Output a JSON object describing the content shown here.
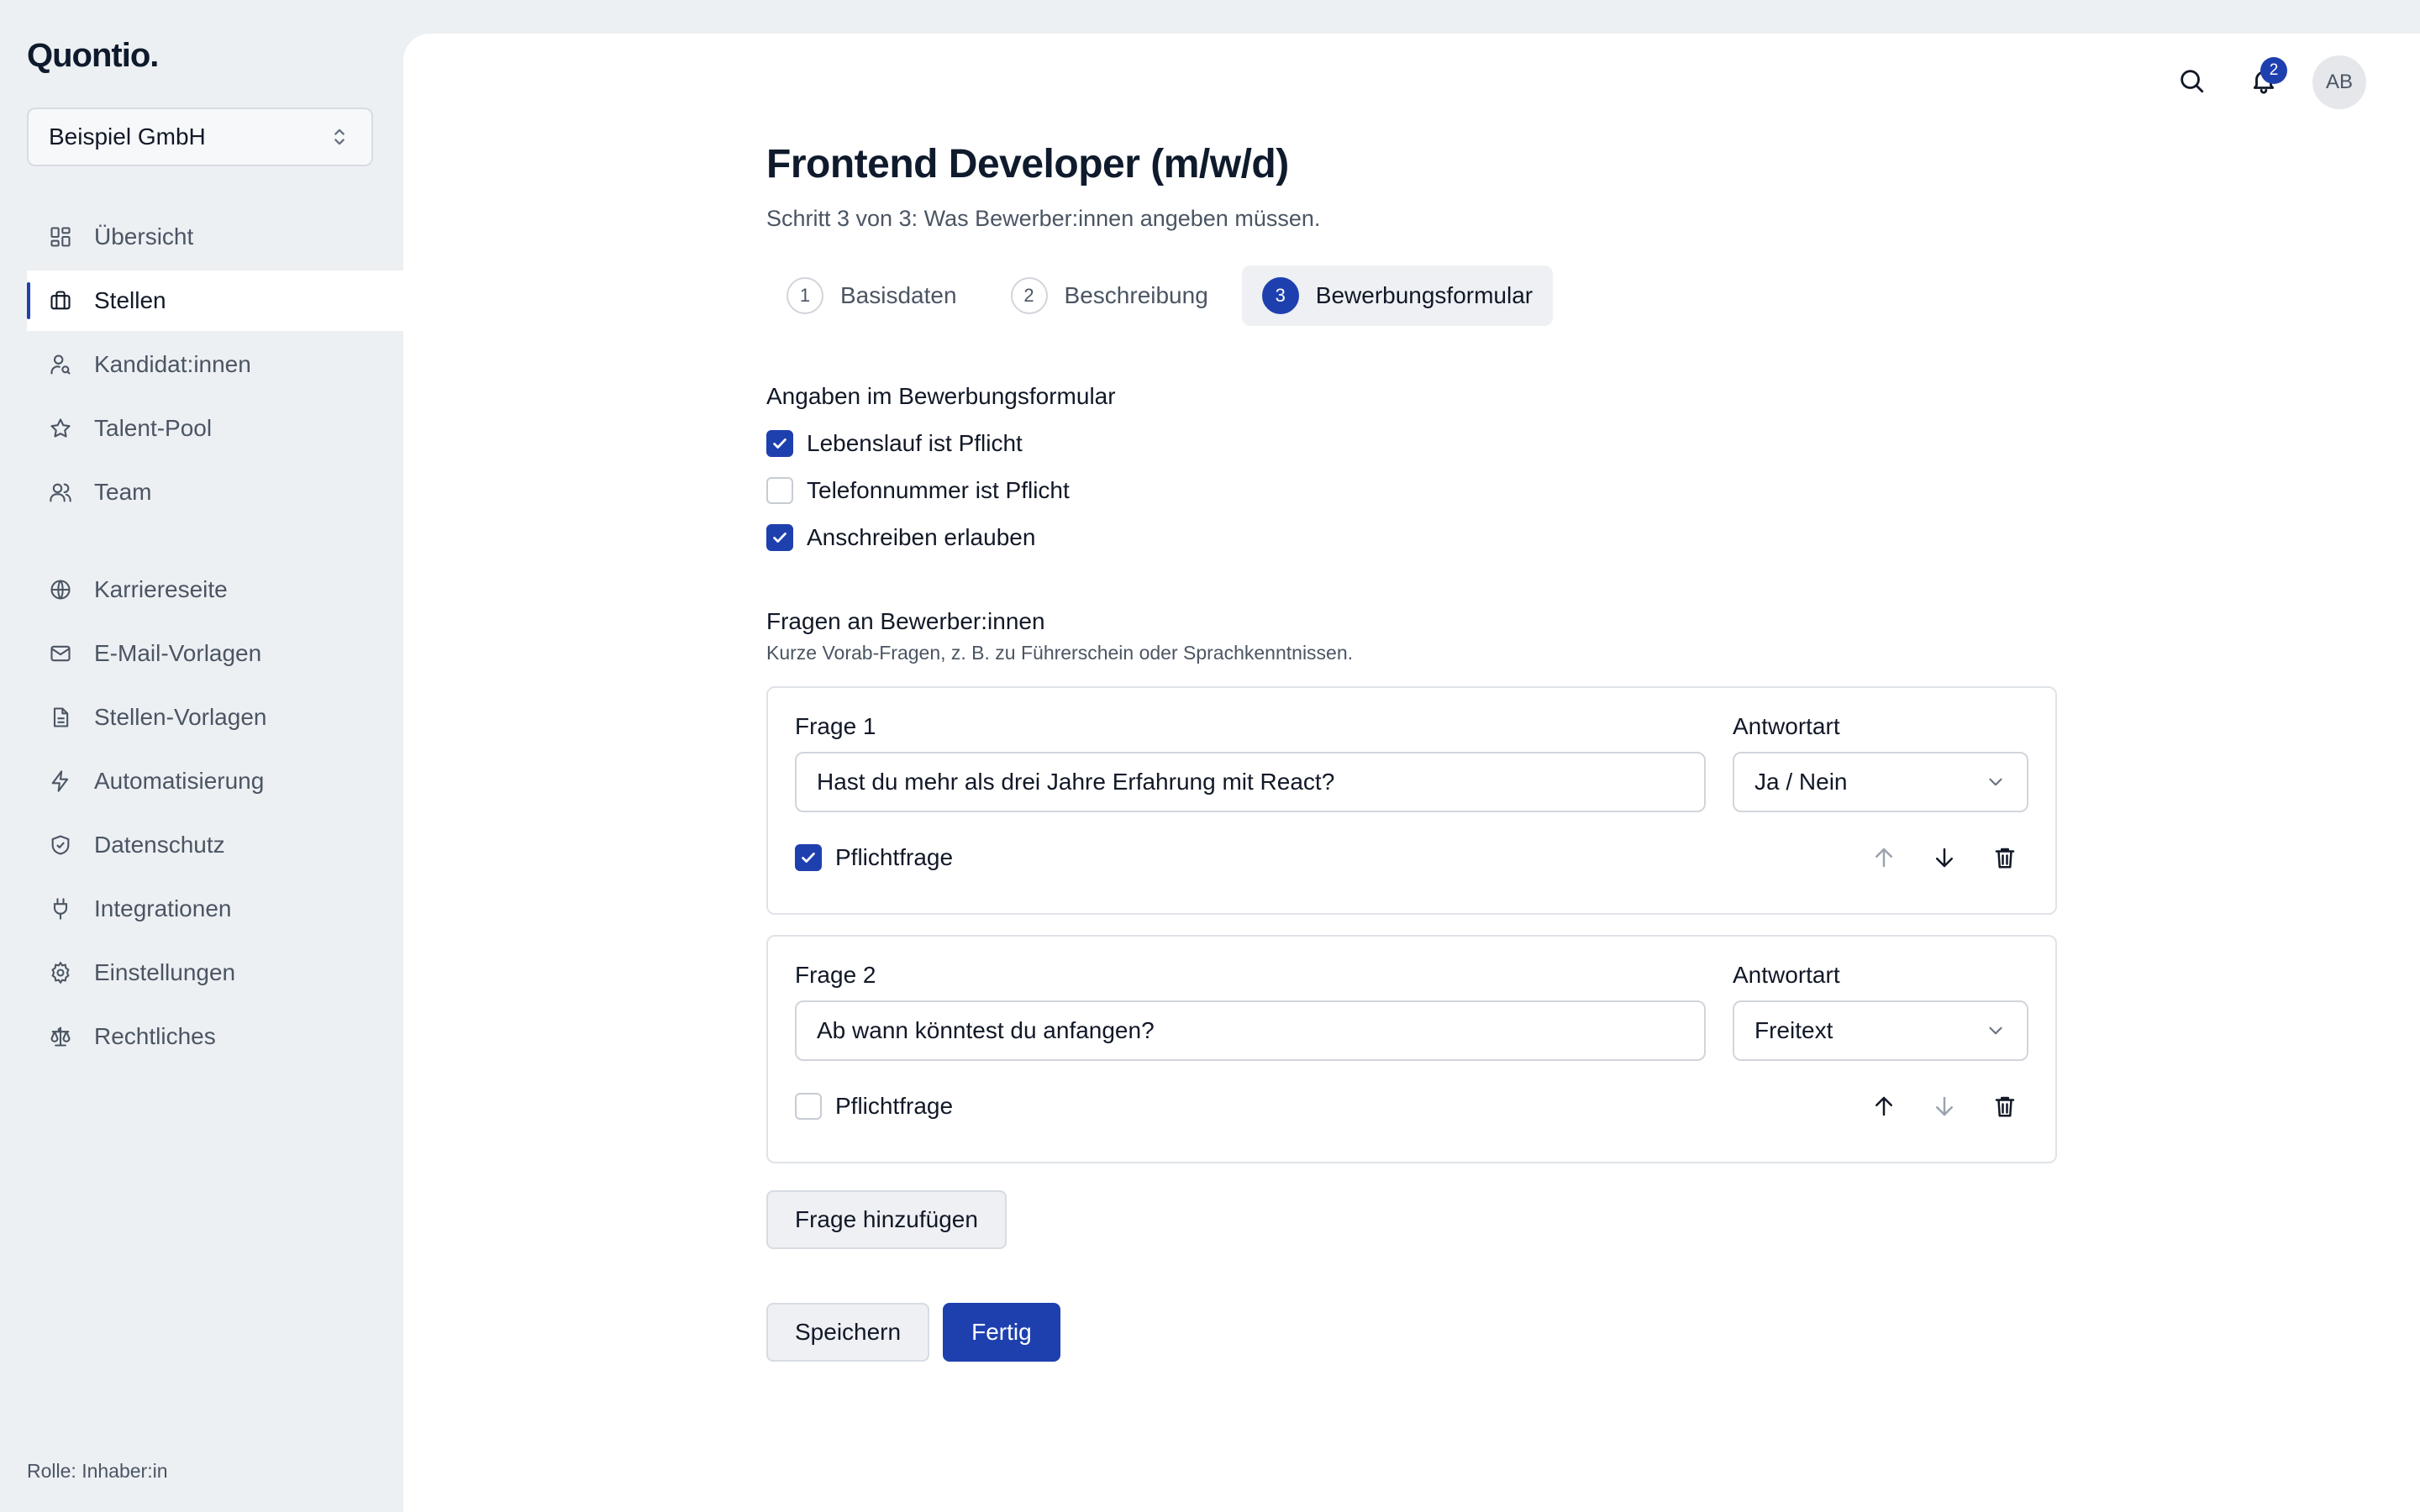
{
  "app": {
    "logo": "Quontio."
  },
  "org_switcher": {
    "label": "Beispiel GmbH"
  },
  "sidebar": {
    "items": [
      {
        "label": "Übersicht",
        "icon": "dashboard-icon"
      },
      {
        "label": "Stellen",
        "icon": "briefcase-icon",
        "active": true
      },
      {
        "label": "Kandidat:innen",
        "icon": "user-search-icon"
      },
      {
        "label": "Talent-Pool",
        "icon": "star-icon"
      },
      {
        "label": "Team",
        "icon": "users-icon"
      },
      {
        "label": "Karriereseite",
        "icon": "globe-icon"
      },
      {
        "label": "E-Mail-Vorlagen",
        "icon": "mail-icon"
      },
      {
        "label": "Stellen-Vorlagen",
        "icon": "document-icon"
      },
      {
        "label": "Automatisierung",
        "icon": "lightning-icon"
      },
      {
        "label": "Datenschutz",
        "icon": "shield-check-icon"
      },
      {
        "label": "Integrationen",
        "icon": "plug-icon"
      },
      {
        "label": "Einstellungen",
        "icon": "gear-icon"
      },
      {
        "label": "Rechtliches",
        "icon": "scale-icon"
      }
    ],
    "role": "Rolle: Inhaber:in"
  },
  "topbar": {
    "notification_count": "2",
    "avatar_initials": "AB"
  },
  "page": {
    "title": "Frontend Developer (m/w/d)",
    "subtitle": "Schritt 3 von 3: Was Bewerber:innen angeben müssen.",
    "steps": [
      {
        "num": "1",
        "label": "Basisdaten"
      },
      {
        "num": "2",
        "label": "Beschreibung"
      },
      {
        "num": "3",
        "label": "Bewerbungsformular",
        "active": true
      }
    ]
  },
  "form_fields": {
    "title": "Angaben im Bewerbungsformular",
    "options": [
      {
        "label": "Lebenslauf ist Pflicht",
        "checked": true
      },
      {
        "label": "Telefonnummer ist Pflicht",
        "checked": false
      },
      {
        "label": "Anschreiben erlauben",
        "checked": true
      }
    ]
  },
  "questions": {
    "title": "Fragen an Bewerber:innen",
    "hint": "Kurze Vorab-Fragen, z. B. zu Führerschein oder Sprachkenntnissen.",
    "answer_type_label": "Antwortart",
    "required_label": "Pflichtfrage",
    "items": [
      {
        "label": "Frage 1",
        "value": "Hast du mehr als drei Jahre Erfahrung mit React?",
        "answer_type": "Ja / Nein",
        "required": true
      },
      {
        "label": "Frage 2",
        "value": "Ab wann könntest du anfangen?",
        "answer_type": "Freitext",
        "required": false
      }
    ],
    "add_label": "Frage hinzufügen"
  },
  "actions": {
    "save_label": "Speichern",
    "finish_label": "Fertig"
  },
  "colors": {
    "accent": "#1e40af",
    "sidebar_bg": "#edf0f3",
    "card_bg": "#ffffff"
  }
}
